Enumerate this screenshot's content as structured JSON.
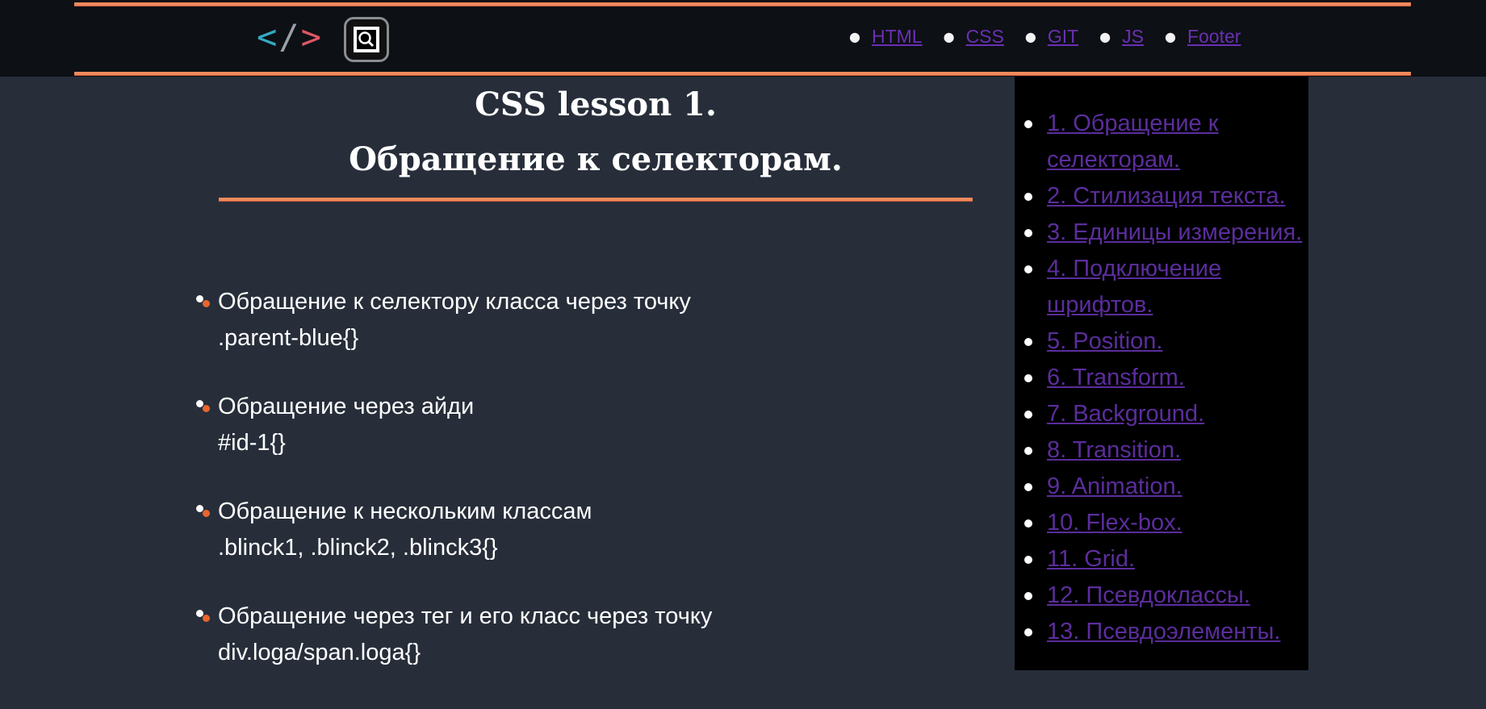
{
  "header": {
    "logo": {
      "lt": "<",
      "slash": "/",
      "gt": ">"
    },
    "search_icon": "search-icon",
    "nav": [
      "HTML",
      "CSS",
      "GIT",
      "JS",
      "Footer"
    ]
  },
  "main": {
    "title_line1": "CSS lesson 1.",
    "title_line2": "Обращение к селекторам.",
    "items": [
      {
        "text": "Обращение к селектору класса через точку",
        "code": ".parent-blue{}"
      },
      {
        "text": "Обращение через айди",
        "code": "#id-1{}"
      },
      {
        "text": "Обращение к нескольким классам",
        "code": ".blinck1, .blinck2, .blinck3{}"
      },
      {
        "text": "Обращение через тег и его класс через точку",
        "code": "div.loga/span.loga{}"
      }
    ]
  },
  "sidebar": {
    "links": [
      "1. Обращение к селекторам.",
      "2. Стилизация текста.",
      "3. Единицы измерения.",
      "4. Подключение шрифтов.",
      "5. Position.",
      "6. Transform.",
      "7. Background.",
      "8. Transition.",
      "9. Animation.",
      "10. Flex-box.",
      "11. Grid.",
      "12. Псевдоклассы.",
      "13. Псевдоэлементы."
    ]
  },
  "colors": {
    "page_bg": "#272e3a",
    "header_bg": "#0d1015",
    "accent_line": "#f08a5d",
    "link": "#6b2fb3",
    "bullet_orange": "#e8652d"
  }
}
